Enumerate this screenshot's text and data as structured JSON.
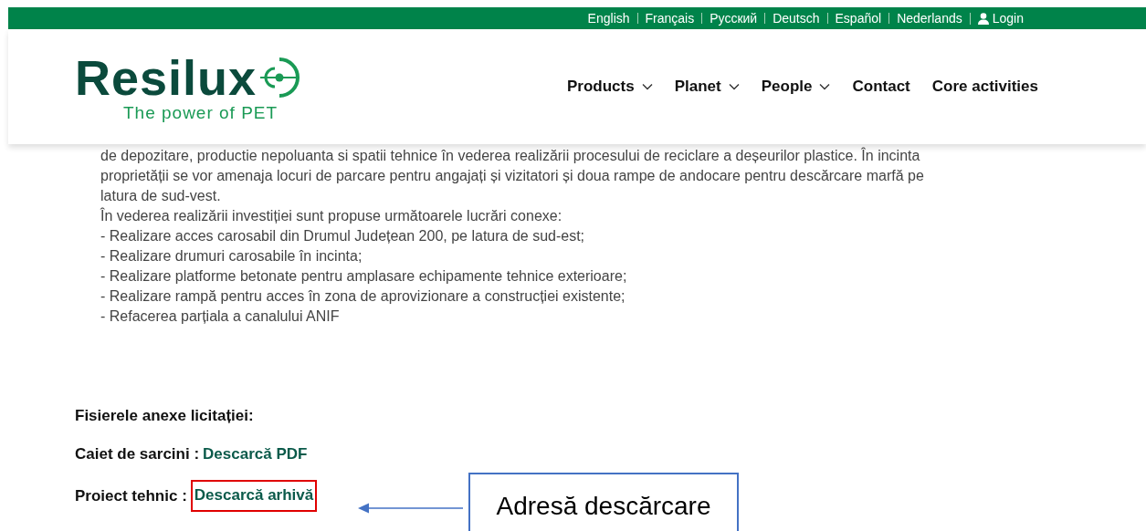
{
  "top_bar": {
    "languages": [
      {
        "label": "English"
      },
      {
        "label": "Français"
      },
      {
        "label": "Русский"
      },
      {
        "label": "Deutsch"
      },
      {
        "label": "Español"
      },
      {
        "label": "Nederlands"
      }
    ],
    "login": "Login"
  },
  "header": {
    "logo": {
      "name": "Resilux",
      "tagline": "The power of PET"
    },
    "nav": [
      {
        "label": "Products",
        "dropdown": true
      },
      {
        "label": "Planet",
        "dropdown": true
      },
      {
        "label": "People",
        "dropdown": true
      },
      {
        "label": "Contact",
        "dropdown": false
      },
      {
        "label": "Core activities",
        "dropdown": false
      }
    ]
  },
  "content": {
    "lines": [
      "de depozitare, productie nepoluanta si spatii tehnice în vederea realizării procesului de reciclare a deșeurilor plastice. În incinta",
      "proprietății se vor amenaja locuri de parcare pentru angajați și vizitatori și doua rampe de andocare pentru descărcare marfă pe",
      "latura de sud-vest.",
      "În vederea realizării investiției sunt propuse următoarele lucrări conexe:",
      "- Realizare acces carosabil din Drumul Județean 200, pe latura de sud-est;",
      "- Realizare drumuri carosabile în incinta;",
      "- Realizare platforme betonate pentru amplasare echipamente tehnice exterioare;",
      "- Realizare rampă pentru acces în zona de aprovizionare a construcției existente;",
      "- Refacerea parțiala a canalului ANIF"
    ],
    "files_heading": "Fisierele anexe licitației:",
    "files": [
      {
        "label": "Caiet de sarcini :",
        "link": "Descarcă PDF",
        "highlighted": false
      },
      {
        "label": "Proiect tehnic :",
        "link": "Descarcă arhivă",
        "highlighted": true
      }
    ]
  },
  "annotation": {
    "callout": "Adresă descărcare"
  }
}
